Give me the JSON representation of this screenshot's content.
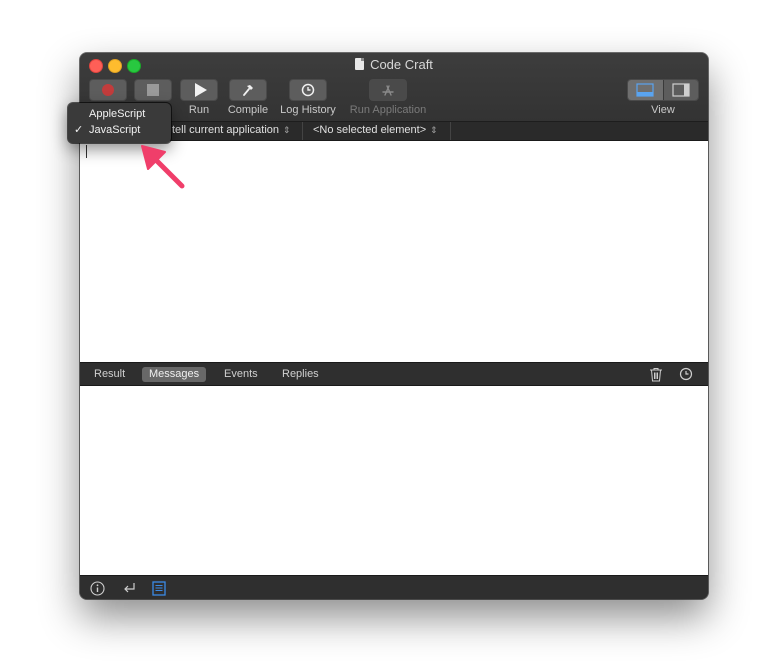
{
  "window": {
    "title": "Code Craft"
  },
  "toolbar": {
    "record_icon": "record-icon",
    "stop_icon": "stop-icon",
    "run_label": "Run",
    "compile_label": "Compile",
    "log_history_label": "Log History",
    "run_application_label": "Run Application",
    "view_label": "View"
  },
  "navbar": {
    "target": "tell current application",
    "element": "<No selected element>"
  },
  "language_menu": {
    "items": [
      {
        "label": "AppleScript",
        "checked": false,
        "check": ""
      },
      {
        "label": "JavaScript",
        "checked": true,
        "check": "✓"
      }
    ]
  },
  "log_tabs": {
    "tabs": [
      {
        "label": "Result",
        "active": false
      },
      {
        "label": "Messages",
        "active": true
      },
      {
        "label": "Events",
        "active": false
      },
      {
        "label": "Replies",
        "active": false
      }
    ]
  },
  "bottom_bar": {
    "icons": [
      "info-icon",
      "return-icon",
      "document-list-icon"
    ]
  },
  "colors": {
    "annotation_arrow": "#f03e6a",
    "accent_blue": "#3b8ae6"
  }
}
